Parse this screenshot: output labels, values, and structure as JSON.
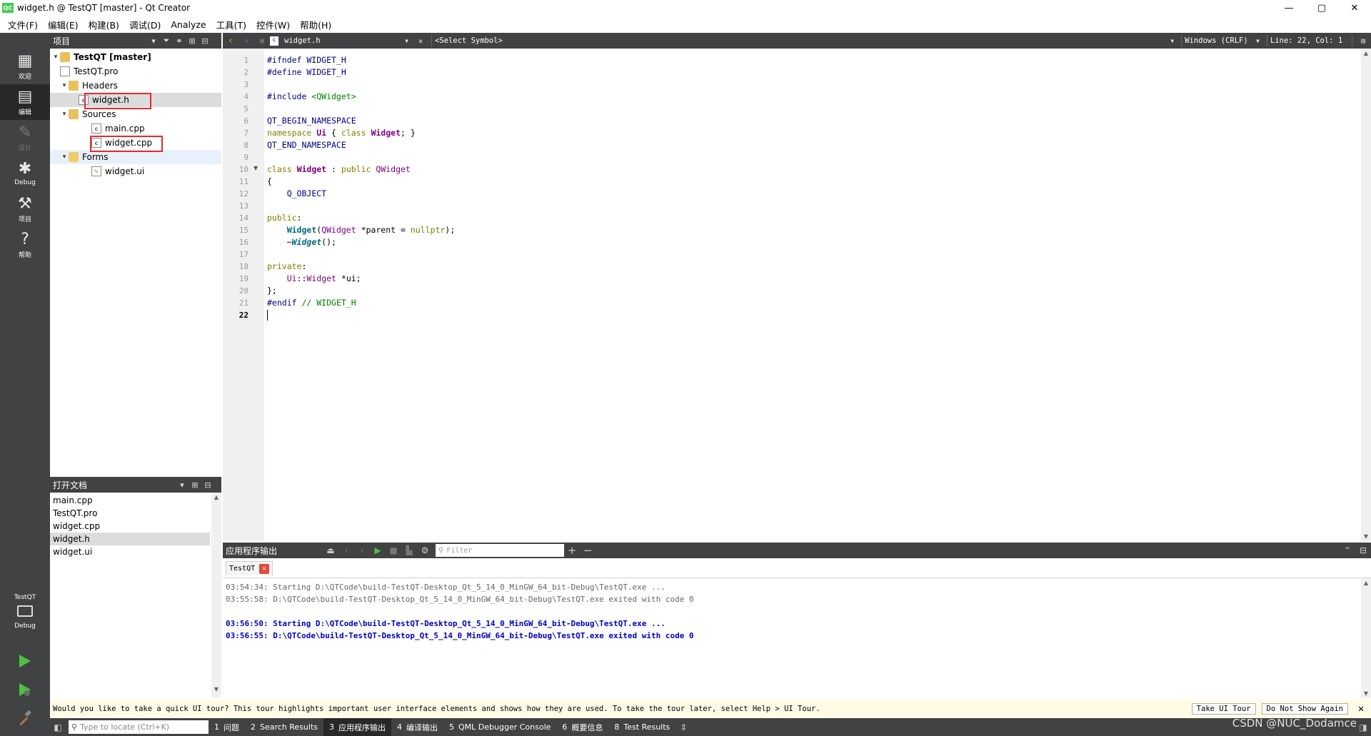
{
  "window": {
    "title": "widget.h @ TestQT [master] - Qt Creator",
    "app_icon": "QC",
    "controls": [
      "—",
      "▢",
      "✕"
    ]
  },
  "menu": [
    "文件(F)",
    "编辑(E)",
    "构建(B)",
    "调试(D)",
    "Analyze",
    "工具(T)",
    "控件(W)",
    "帮助(H)"
  ],
  "modes": [
    {
      "label": "欢迎",
      "icon": "grid-icon"
    },
    {
      "label": "编辑",
      "icon": "edit-doc-icon"
    },
    {
      "label": "设计",
      "icon": "pencil-icon"
    },
    {
      "label": "Debug",
      "icon": "bug-icon"
    },
    {
      "label": "项目",
      "icon": "wrench-icon"
    },
    {
      "label": "帮助",
      "icon": "help-icon"
    }
  ],
  "kit": {
    "project": "TestQT",
    "config": "Debug"
  },
  "project_pane": {
    "title": "项目",
    "tree": [
      {
        "label": "TestQT [master]",
        "bold": true
      },
      {
        "label": "TestQT.pro"
      },
      {
        "label": "Headers"
      },
      {
        "label": "widget.h"
      },
      {
        "label": "Sources"
      },
      {
        "label": "main.cpp"
      },
      {
        "label": "widget.cpp"
      },
      {
        "label": "Forms"
      },
      {
        "label": "widget.ui"
      }
    ]
  },
  "open_docs": {
    "title": "打开文档",
    "items": [
      "main.cpp",
      "TestQT.pro",
      "widget.cpp",
      "widget.h",
      "widget.ui"
    ]
  },
  "editor_toolbar": {
    "file": "widget.h",
    "symbol": "<Select Symbol>",
    "encoding": "Windows (CRLF)",
    "position": "Line: 22, Col: 1"
  },
  "code": {
    "line_numbers": [
      "1",
      "2",
      "3",
      "4",
      "5",
      "6",
      "7",
      "8",
      "9",
      "10",
      "11",
      "12",
      "13",
      "14",
      "15",
      "16",
      "17",
      "18",
      "19",
      "20",
      "21",
      "22"
    ],
    "current_line": 22
  },
  "output_pane": {
    "title": "应用程序输出",
    "filter_placeholder": "Filter",
    "tab": "TestQT",
    "lines": [
      "03:54:34: Starting D:\\QTCode\\build-TestQT-Desktop_Qt_5_14_0_MinGW_64_bit-Debug\\TestQT.exe ...",
      "03:55:58: D:\\QTCode\\build-TestQT-Desktop_Qt_5_14_0_MinGW_64_bit-Debug\\TestQT.exe exited with code 0",
      "",
      "03:56:50: Starting D:\\QTCode\\build-TestQT-Desktop_Qt_5_14_0_MinGW_64_bit-Debug\\TestQT.exe ...",
      "03:56:55: D:\\QTCode\\build-TestQT-Desktop_Qt_5_14_0_MinGW_64_bit-Debug\\TestQT.exe exited with code 0"
    ]
  },
  "infobar": {
    "text": "Would you like to take a quick UI tour? This tour highlights important user interface elements and shows how they are used. To take the tour later, select Help > UI Tour.",
    "take_tour": "Take UI Tour",
    "dont_show": "Do Not Show Again"
  },
  "statusbar": {
    "locator_placeholder": "Type to locate (Ctrl+K)",
    "tabs": [
      {
        "num": "1",
        "label": "问题"
      },
      {
        "num": "2",
        "label": "Search Results"
      },
      {
        "num": "3",
        "label": "应用程序输出"
      },
      {
        "num": "4",
        "label": "编译输出"
      },
      {
        "num": "5",
        "label": "QML Debugger Console"
      },
      {
        "num": "6",
        "label": "概要信息"
      },
      {
        "num": "8",
        "label": "Test Results"
      }
    ]
  },
  "watermark": "CSDN @NUC_Dodamce",
  "colors": {
    "dark_panel": "#404244",
    "active_mode": "#262829",
    "highlight_box": "#e52b2b",
    "output_blue": "#0000c0"
  }
}
